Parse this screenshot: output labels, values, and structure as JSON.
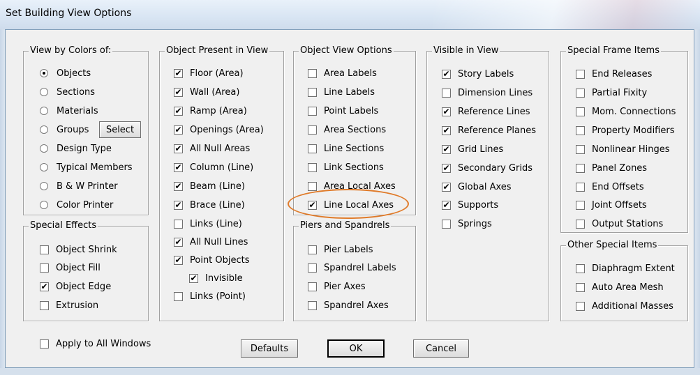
{
  "window": {
    "title": "Set Building View Options"
  },
  "groups": {
    "view_by_colors": {
      "title": "View by Colors of:",
      "options": [
        {
          "label": "Objects",
          "selected": true
        },
        {
          "label": "Sections",
          "selected": false
        },
        {
          "label": "Materials",
          "selected": false
        },
        {
          "label": "Groups",
          "selected": false
        },
        {
          "label": "Design Type",
          "selected": false
        },
        {
          "label": "Typical Members",
          "selected": false
        },
        {
          "label": "B & W Printer",
          "selected": false
        },
        {
          "label": "Color Printer",
          "selected": false
        }
      ],
      "select_button": "Select"
    },
    "special_effects": {
      "title": "Special Effects",
      "items": [
        {
          "label": "Object Shrink",
          "checked": false
        },
        {
          "label": "Object Fill",
          "checked": false
        },
        {
          "label": "Object Edge",
          "checked": true
        },
        {
          "label": "Extrusion",
          "checked": false
        }
      ]
    },
    "object_present": {
      "title": "Object Present in View",
      "items": [
        {
          "label": "Floor (Area)",
          "checked": true
        },
        {
          "label": "Wall (Area)",
          "checked": true
        },
        {
          "label": "Ramp (Area)",
          "checked": true
        },
        {
          "label": "Openings (Area)",
          "checked": true
        },
        {
          "label": "All Null Areas",
          "checked": true
        },
        {
          "label": "Column (Line)",
          "checked": true
        },
        {
          "label": "Beam (Line)",
          "checked": true
        },
        {
          "label": "Brace (Line)",
          "checked": true
        },
        {
          "label": "Links (Line)",
          "checked": false
        },
        {
          "label": "All Null Lines",
          "checked": true
        },
        {
          "label": "Point Objects",
          "checked": true
        },
        {
          "label": "Invisible",
          "checked": true
        },
        {
          "label": "Links (Point)",
          "checked": false
        }
      ]
    },
    "object_view_options": {
      "title": "Object View Options",
      "items": [
        {
          "label": "Area Labels",
          "checked": false
        },
        {
          "label": "Line Labels",
          "checked": false
        },
        {
          "label": "Point Labels",
          "checked": false
        },
        {
          "label": "Area Sections",
          "checked": false
        },
        {
          "label": "Line Sections",
          "checked": false
        },
        {
          "label": "Link Sections",
          "checked": false
        },
        {
          "label": "Area Local Axes",
          "checked": false
        },
        {
          "label": "Line Local Axes",
          "checked": true
        }
      ]
    },
    "piers_spandrels": {
      "title": "Piers and Spandrels",
      "items": [
        {
          "label": "Pier Labels",
          "checked": false
        },
        {
          "label": "Spandrel Labels",
          "checked": false
        },
        {
          "label": "Pier Axes",
          "checked": false
        },
        {
          "label": "Spandrel Axes",
          "checked": false
        }
      ]
    },
    "visible_in_view": {
      "title": "Visible in View",
      "items": [
        {
          "label": "Story Labels",
          "checked": true
        },
        {
          "label": "Dimension Lines",
          "checked": false
        },
        {
          "label": "Reference Lines",
          "checked": true
        },
        {
          "label": "Reference Planes",
          "checked": true
        },
        {
          "label": "Grid Lines",
          "checked": true
        },
        {
          "label": "Secondary Grids",
          "checked": true
        },
        {
          "label": "Global Axes",
          "checked": true
        },
        {
          "label": "Supports",
          "checked": true
        },
        {
          "label": "Springs",
          "checked": false
        }
      ]
    },
    "special_frame_items": {
      "title": "Special Frame Items",
      "items": [
        {
          "label": "End Releases",
          "checked": false
        },
        {
          "label": "Partial Fixity",
          "checked": false
        },
        {
          "label": "Mom. Connections",
          "checked": false
        },
        {
          "label": "Property Modifiers",
          "checked": false
        },
        {
          "label": "Nonlinear Hinges",
          "checked": false
        },
        {
          "label": "Panel Zones",
          "checked": false
        },
        {
          "label": "End Offsets",
          "checked": false
        },
        {
          "label": "Joint Offsets",
          "checked": false
        },
        {
          "label": "Output Stations",
          "checked": false
        }
      ]
    },
    "other_special_items": {
      "title": "Other Special Items",
      "items": [
        {
          "label": "Diaphragm Extent",
          "checked": false
        },
        {
          "label": "Auto Area Mesh",
          "checked": false
        },
        {
          "label": "Additional Masses",
          "checked": false
        }
      ]
    }
  },
  "apply_all": {
    "label": "Apply to All Windows",
    "checked": false
  },
  "buttons": {
    "defaults": "Defaults",
    "ok": "OK",
    "cancel": "Cancel"
  },
  "colors": {
    "highlight": "#e07b2a",
    "dialog_bg": "#f0f0f0"
  },
  "icons": {
    "checkmark": "checkmark-icon",
    "radio_dot": "radio-dot-icon"
  }
}
